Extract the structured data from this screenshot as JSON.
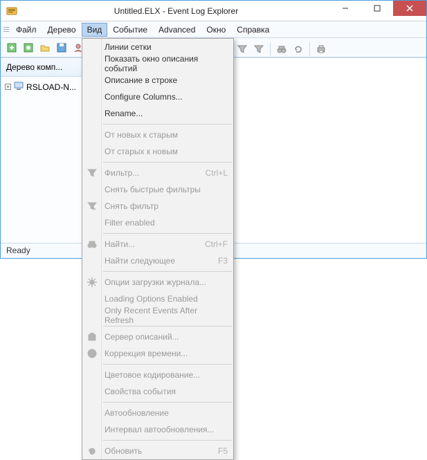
{
  "window": {
    "title": "Untitled.ELX - Event Log Explorer"
  },
  "menubar": {
    "items": [
      "Файл",
      "Дерево",
      "Вид",
      "Событие",
      "Advanced",
      "Окно",
      "Справка"
    ],
    "active_index": 2
  },
  "sidebar": {
    "header": "Дерево комп...",
    "tree_item": "RSLOAD-N..."
  },
  "statusbar": {
    "text": "Ready"
  },
  "dropdown": {
    "groups": [
      [
        {
          "label": "Линии сетки",
          "shortcut": "",
          "disabled": false,
          "icon": null
        },
        {
          "label": "Показать окно описания событий",
          "shortcut": "",
          "disabled": false,
          "icon": null
        },
        {
          "label": "Описание в строке",
          "shortcut": "",
          "disabled": false,
          "icon": null
        },
        {
          "label": "Configure Columns...",
          "shortcut": "",
          "disabled": false,
          "icon": null
        },
        {
          "label": "Rename...",
          "shortcut": "",
          "disabled": false,
          "icon": null
        }
      ],
      [
        {
          "label": "От новых к старым",
          "shortcut": "",
          "disabled": true,
          "icon": null
        },
        {
          "label": "От старых к новым",
          "shortcut": "",
          "disabled": true,
          "icon": null
        }
      ],
      [
        {
          "label": "Фильтр...",
          "shortcut": "Ctrl+L",
          "disabled": true,
          "icon": "funnel"
        },
        {
          "label": "Снять быстрые фильтры",
          "shortcut": "",
          "disabled": true,
          "icon": null
        },
        {
          "label": "Снять фильтр",
          "shortcut": "",
          "disabled": true,
          "icon": "funnel-x"
        },
        {
          "label": "Filter enabled",
          "shortcut": "",
          "disabled": true,
          "icon": null
        }
      ],
      [
        {
          "label": "Найти...",
          "shortcut": "Ctrl+F",
          "disabled": true,
          "icon": "binoculars"
        },
        {
          "label": "Найти следующее",
          "shortcut": "F3",
          "disabled": true,
          "icon": null
        }
      ],
      [
        {
          "label": "Опции загрузки журнала...",
          "shortcut": "",
          "disabled": true,
          "icon": "gear"
        },
        {
          "label": "Loading Options Enabled",
          "shortcut": "",
          "disabled": true,
          "icon": null
        },
        {
          "label": "Only Recent Events After Refresh",
          "shortcut": "",
          "disabled": true,
          "icon": null
        }
      ],
      [
        {
          "label": "Сервер описаний...",
          "shortcut": "",
          "disabled": true,
          "icon": "box"
        },
        {
          "label": "Коррекция времени...",
          "shortcut": "",
          "disabled": true,
          "icon": "clock"
        }
      ],
      [
        {
          "label": "Цветовое кодирование...",
          "shortcut": "",
          "disabled": true,
          "icon": null
        },
        {
          "label": "Свойства события",
          "shortcut": "",
          "disabled": true,
          "icon": null
        }
      ],
      [
        {
          "label": "Автообновление",
          "shortcut": "",
          "disabled": true,
          "icon": null
        },
        {
          "label": "Интервал автообновления...",
          "shortcut": "",
          "disabled": true,
          "icon": null
        }
      ],
      [
        {
          "label": "Обновить",
          "shortcut": "F5",
          "disabled": true,
          "icon": "refresh"
        }
      ]
    ]
  }
}
